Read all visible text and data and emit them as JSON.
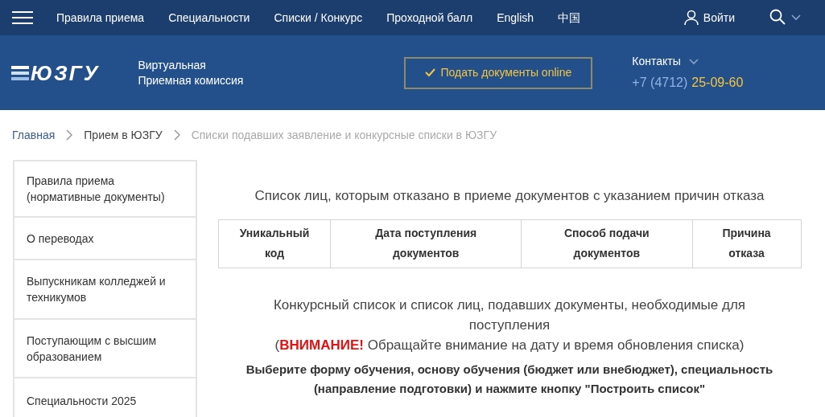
{
  "top_nav": {
    "items": [
      "Правила приема",
      "Специальности",
      "Списки / Конкурс",
      "Проходной балл",
      "English",
      "中国"
    ],
    "login": "Войти"
  },
  "header": {
    "logo": "ЮЗГУ",
    "subtitle_lines": [
      "Виртуальная",
      "Приемная комиссия"
    ],
    "submit_button": "Подать документы online",
    "contacts_label": "Контакты",
    "phone_code": "+7 (4712)",
    "phone_number": "25-09-60"
  },
  "breadcrumbs": [
    "Главная",
    "Прием в ЮЗГУ",
    "Списки подавших заявление и конкурсные списки в ЮЗГУ"
  ],
  "sidebar": {
    "items": [
      "Правила приема (нормативные документы)",
      "О переводах",
      "Выпускникам колледжей и техникумов",
      "Поступающим с высшим образованием",
      "Специальности 2025"
    ]
  },
  "refusal_section": {
    "title": "Список лиц, которым отказано в приеме документов с указанием причин отказа",
    "table": {
      "columns": [
        "Уникальный код",
        "Дата поступления документов",
        "Способ подачи документов",
        "Причина отказа"
      ]
    }
  },
  "competition_section": {
    "title": "Конкурсный список и список лиц, подавших документы, необходимые для поступления",
    "notice": "(**ВНИМАНИЕ!** Обращайте внимание на дату и время обновления списка)",
    "instruction": "Выберите форму обучения, основу обучения (бюджет или внебюджет), специальность (направление подготовки) и нажмите кнопку \"Построить список\""
  }
}
